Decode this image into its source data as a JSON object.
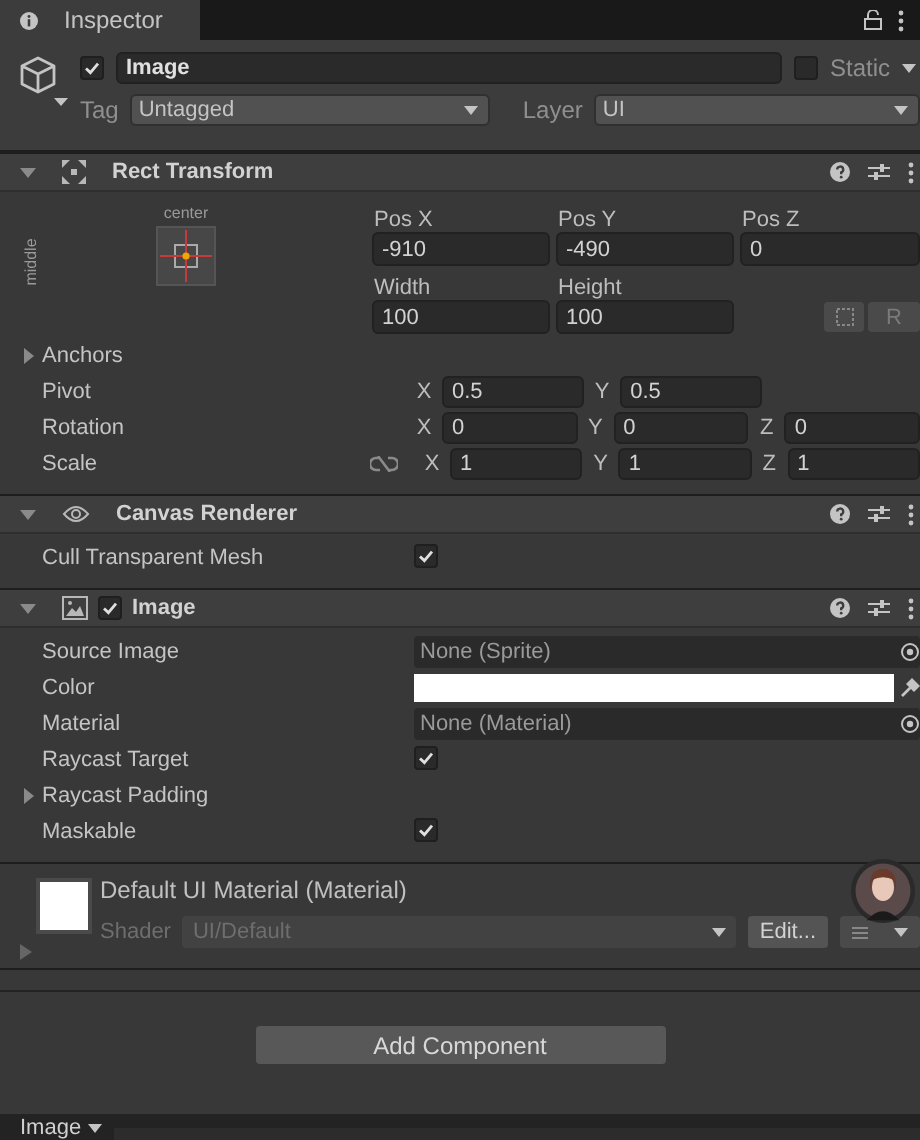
{
  "tab": {
    "label": "Inspector"
  },
  "header": {
    "enabled": true,
    "name": "Image",
    "static": {
      "label": "Static",
      "checked": false
    },
    "tag": {
      "label": "Tag",
      "value": "Untagged"
    },
    "layer": {
      "label": "Layer",
      "value": "UI"
    }
  },
  "components": [
    {
      "kind": "rect_transform",
      "title": "Rect Transform",
      "expanded": true,
      "anchor": {
        "horizontal": "center",
        "vertical": "middle"
      },
      "grid": [
        [
          {
            "label": "Pos X",
            "value": "-910"
          },
          {
            "label": "Pos Y",
            "value": "-490"
          },
          {
            "label": "Pos Z",
            "value": "0"
          }
        ],
        [
          {
            "label": "Width",
            "value": "100"
          },
          {
            "label": "Height",
            "value": "100"
          }
        ]
      ],
      "raw_button": "R",
      "rows": [
        {
          "kind": "foldout",
          "label": "Anchors",
          "expanded": false
        },
        {
          "kind": "vector",
          "label": "Pivot",
          "fields": [
            {
              "axis": "X",
              "value": "0.5"
            },
            {
              "axis": "Y",
              "value": "0.5"
            }
          ]
        },
        {
          "kind": "vector",
          "label": "Rotation",
          "fields": [
            {
              "axis": "X",
              "value": "0"
            },
            {
              "axis": "Y",
              "value": "0"
            },
            {
              "axis": "Z",
              "value": "0"
            }
          ]
        },
        {
          "kind": "vector",
          "label": "Scale",
          "linked": false,
          "fields": [
            {
              "axis": "X",
              "value": "1"
            },
            {
              "axis": "Y",
              "value": "1"
            },
            {
              "axis": "Z",
              "value": "1"
            }
          ]
        }
      ]
    },
    {
      "kind": "canvas_renderer",
      "title": "Canvas Renderer",
      "expanded": true,
      "rows": [
        {
          "kind": "check",
          "label": "Cull Transparent Mesh",
          "checked": true
        }
      ]
    },
    {
      "kind": "image",
      "title": "Image",
      "expanded": true,
      "enabled": true,
      "rows": [
        {
          "kind": "object",
          "label": "Source Image",
          "value": "None (Sprite)"
        },
        {
          "kind": "color",
          "label": "Color",
          "color": "#ffffff"
        },
        {
          "kind": "object",
          "label": "Material",
          "value": "None (Material)"
        },
        {
          "kind": "check",
          "label": "Raycast Target",
          "checked": true
        },
        {
          "kind": "foldout",
          "label": "Raycast Padding",
          "expanded": false
        },
        {
          "kind": "check",
          "label": "Maskable",
          "checked": true
        }
      ]
    }
  ],
  "material": {
    "name": "Default UI Material (Material)",
    "shader_label": "Shader",
    "shader": "UI/Default",
    "edit": "Edit..."
  },
  "add_component": "Add Component",
  "bottom_tab": "Image"
}
